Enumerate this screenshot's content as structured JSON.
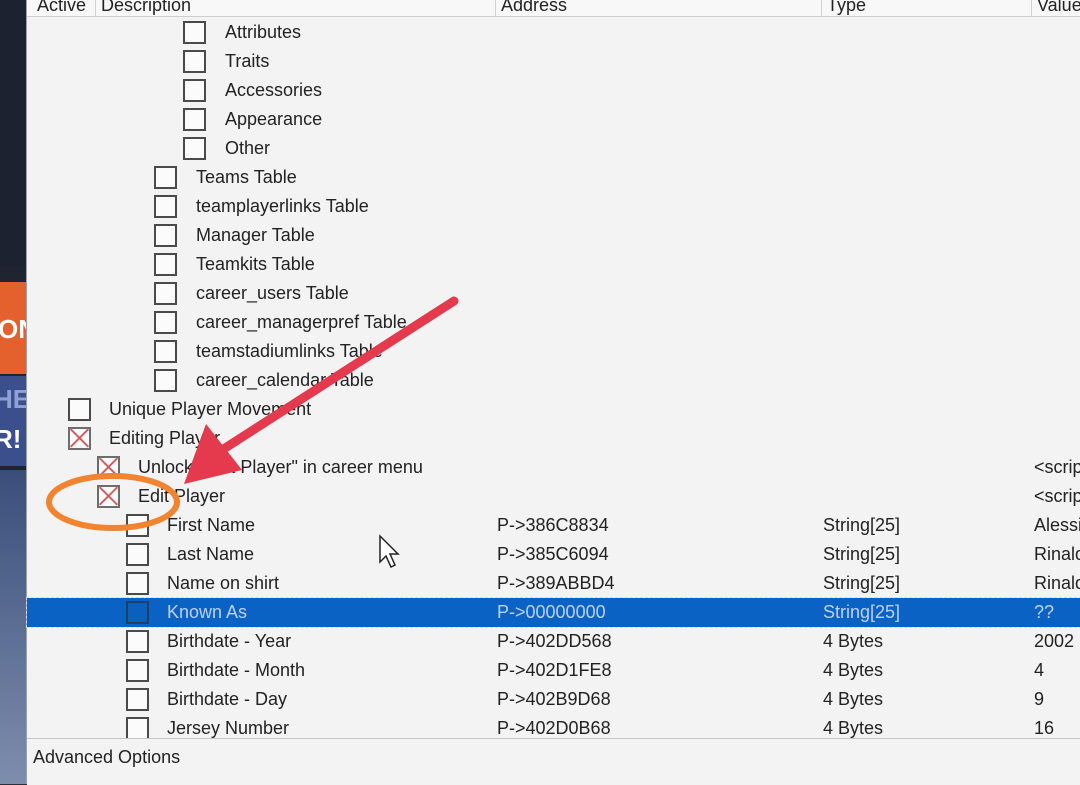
{
  "columns": {
    "active": "Active",
    "description": "Description",
    "address": "Address",
    "type": "Type",
    "value": "Value"
  },
  "rows": [
    {
      "description": "Attributes",
      "address": "",
      "type": "",
      "value": "",
      "checked": false
    },
    {
      "description": "Traits",
      "address": "",
      "type": "",
      "value": "",
      "checked": false
    },
    {
      "description": "Accessories",
      "address": "",
      "type": "",
      "value": "",
      "checked": false
    },
    {
      "description": "Appearance",
      "address": "",
      "type": "",
      "value": "",
      "checked": false
    },
    {
      "description": "Other",
      "address": "",
      "type": "",
      "value": "",
      "checked": false
    },
    {
      "description": "Teams Table",
      "address": "",
      "type": "",
      "value": "",
      "checked": false
    },
    {
      "description": "teamplayerlinks Table",
      "address": "",
      "type": "",
      "value": "",
      "checked": false
    },
    {
      "description": "Manager Table",
      "address": "",
      "type": "",
      "value": "",
      "checked": false
    },
    {
      "description": "Teamkits Table",
      "address": "",
      "type": "",
      "value": "",
      "checked": false
    },
    {
      "description": "career_users Table",
      "address": "",
      "type": "",
      "value": "",
      "checked": false
    },
    {
      "description": "career_managerpref Table",
      "address": "",
      "type": "",
      "value": "",
      "checked": false
    },
    {
      "description": "teamstadiumlinks Table",
      "address": "",
      "type": "",
      "value": "",
      "checked": false
    },
    {
      "description": "career_calendar Table",
      "address": "",
      "type": "",
      "value": "",
      "checked": false
    },
    {
      "description": "Unique Player Movement",
      "address": "",
      "type": "",
      "value": "",
      "checked": false
    },
    {
      "description": "Editing Player",
      "address": "",
      "type": "",
      "value": "",
      "checked": true
    },
    {
      "description": "Unlock \"Edit Player\" in career menu",
      "address": "",
      "type": "",
      "value": "<script>",
      "checked": true
    },
    {
      "description": "Edit Player",
      "address": "",
      "type": "",
      "value": "<script>",
      "checked": true
    },
    {
      "description": "First Name",
      "address": "P->386C8834",
      "type": "String[25]",
      "value": "Alessio",
      "checked": false
    },
    {
      "description": "Last Name",
      "address": "P->385C6094",
      "type": "String[25]",
      "value": "Rinaldi",
      "checked": false
    },
    {
      "description": "Name on shirt",
      "address": "P->389ABBD4",
      "type": "String[25]",
      "value": "Rinaldi",
      "checked": false
    },
    {
      "description": "Known As",
      "address": "P->00000000",
      "type": "String[25]",
      "value": "??",
      "checked": false
    },
    {
      "description": "Birthdate - Year",
      "address": "P->402DD568",
      "type": "4 Bytes",
      "value": "2002",
      "checked": false
    },
    {
      "description": "Birthdate - Month",
      "address": "P->402D1FE8",
      "type": "4 Bytes",
      "value": "4",
      "checked": false
    },
    {
      "description": "Birthdate - Day",
      "address": "P->402B9D68",
      "type": "4 Bytes",
      "value": "9",
      "checked": false
    },
    {
      "description": "Jersey Number",
      "address": "P->402D0B68",
      "type": "4 Bytes",
      "value": "16",
      "checked": false
    }
  ],
  "status_bar": {
    "label": "Advanced Options"
  },
  "background_fragments": {
    "line1": "ON",
    "line2": "HE",
    "line3": "R!"
  },
  "colors": {
    "selection": "#0a63c4",
    "arrow": "#e5394d",
    "highlight_ellipse": "#f28430",
    "checkbox_x": "#cf5f5f"
  }
}
